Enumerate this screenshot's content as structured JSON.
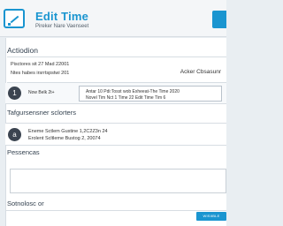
{
  "header": {
    "title": "Edit Time",
    "subtitle": "Pireker Nare Vaenseet"
  },
  "section_action": {
    "title": "Actiodion",
    "line1": "Pisctores sit 27 Mad 22001",
    "line2": "Ntes habes irsrrtspstwi 201",
    "tag": "Acker Cbsasunr"
  },
  "time_row": {
    "number": "1",
    "label": "Now Belk 2t+",
    "line1": "Antar 10 Pdi:Tosst wob Exheeat-The Time 2020",
    "line2": "Novel Tim Nct 1 Time 22 Edit Time Tim 6"
  },
  "section_supervisor": {
    "title": "Tafgursensner sclorters",
    "number": "a",
    "line1": "Eneme Sctlem Gustine 1,2C2Z3n 24",
    "line2": "Erolent Scltleme Bustog 2, 20074"
  },
  "section_comments": {
    "title": "Pessencas",
    "textarea_value": ""
  },
  "section_footer": {
    "title": "Sotnolosc or",
    "save_label": "WISIIBLE SCOSEE"
  }
}
